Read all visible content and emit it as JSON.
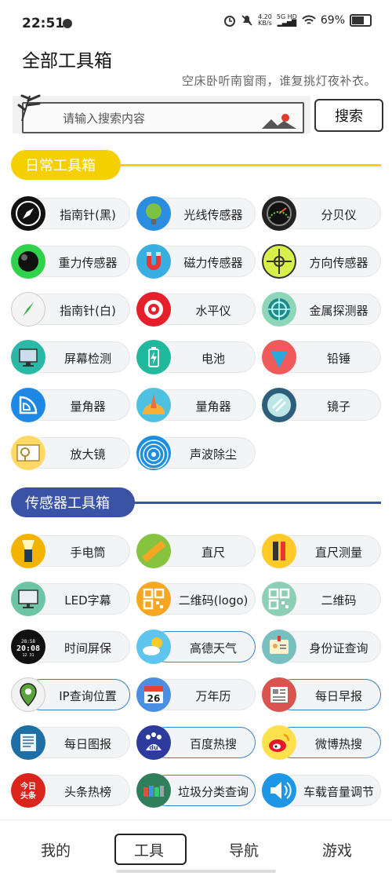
{
  "status": {
    "time": "22:51",
    "net_speed_top": "4.20",
    "net_speed_unit": "KB/s",
    "net_type": "5G HD",
    "battery": "69%"
  },
  "header": {
    "title": "全部工具箱",
    "poem": "空床卧听南窗雨，谁复挑灯夜补衣。"
  },
  "search": {
    "placeholder": "请输入搜索内容",
    "button": "搜索"
  },
  "sections": {
    "daily": {
      "title": "日常工具箱",
      "color": "#f5d000"
    },
    "sensor": {
      "title": "传感器工具箱",
      "color": "#3a53a4"
    }
  },
  "daily_tools": [
    {
      "label": "指南针(黑)",
      "icon": "compass-black-icon"
    },
    {
      "label": "光线传感器",
      "icon": "light-sensor-icon"
    },
    {
      "label": "分贝仪",
      "icon": "decibel-meter-icon"
    },
    {
      "label": "重力传感器",
      "icon": "gravity-sensor-icon"
    },
    {
      "label": "磁力传感器",
      "icon": "magnet-icon"
    },
    {
      "label": "方向传感器",
      "icon": "direction-sensor-icon"
    },
    {
      "label": "指南针(白)",
      "icon": "compass-white-icon"
    },
    {
      "label": "水平仪",
      "icon": "level-icon"
    },
    {
      "label": "金属探测器",
      "icon": "metal-detector-icon"
    },
    {
      "label": "屏幕检测",
      "icon": "screen-test-icon"
    },
    {
      "label": "电池",
      "icon": "battery-icon"
    },
    {
      "label": "铅锤",
      "icon": "plumb-bob-icon"
    },
    {
      "label": "量角器",
      "icon": "protractor-blue-icon"
    },
    {
      "label": "量角器",
      "icon": "protractor-orange-icon"
    },
    {
      "label": "镜子",
      "icon": "mirror-icon"
    },
    {
      "label": "放大镜",
      "icon": "magnifier-icon"
    },
    {
      "label": "声波除尘",
      "icon": "sound-wave-icon"
    }
  ],
  "sensor_tools": [
    {
      "label": "手电筒",
      "icon": "flashlight-icon"
    },
    {
      "label": "直尺",
      "icon": "ruler-icon"
    },
    {
      "label": "直尺测量",
      "icon": "ruler-measure-icon"
    },
    {
      "label": "LED字幕",
      "icon": "led-screen-icon"
    },
    {
      "label": "二维码(logo)",
      "icon": "qrcode-logo-icon"
    },
    {
      "label": "二维码",
      "icon": "qrcode-icon"
    },
    {
      "label": "时间屏保",
      "icon": "clock-icon"
    },
    {
      "label": "高德天气",
      "icon": "weather-icon"
    },
    {
      "label": "身份证查询",
      "icon": "id-card-icon"
    },
    {
      "label": "IP查询位置",
      "icon": "location-icon"
    },
    {
      "label": "万年历",
      "icon": "calendar-icon",
      "calendar_day": "26"
    },
    {
      "label": "每日早报",
      "icon": "newspaper-icon"
    },
    {
      "label": "每日图报",
      "icon": "image-news-icon"
    },
    {
      "label": "百度热搜",
      "icon": "baidu-icon",
      "icon_text": "du"
    },
    {
      "label": "微博热搜",
      "icon": "weibo-icon"
    },
    {
      "label": "头条热榜",
      "icon": "toutiao-icon",
      "icon_text": "今日头条"
    },
    {
      "label": "垃圾分类查询",
      "icon": "trash-sort-icon"
    },
    {
      "label": "车载音量调节",
      "icon": "volume-icon"
    }
  ],
  "nav": {
    "items": [
      "我的",
      "工具",
      "导航",
      "游戏"
    ],
    "active": "工具"
  }
}
